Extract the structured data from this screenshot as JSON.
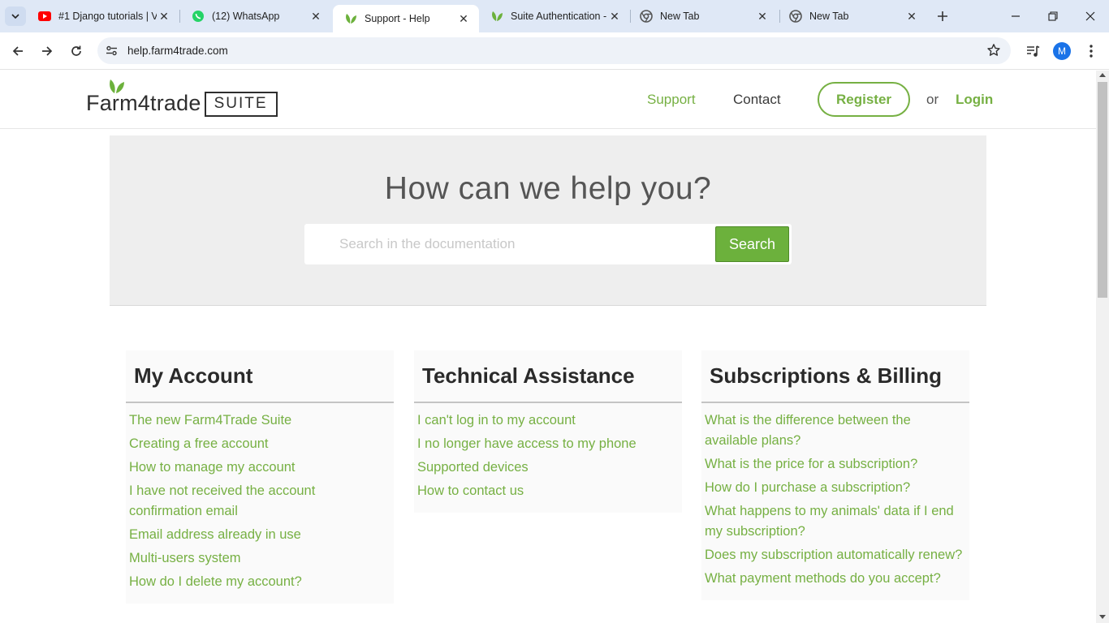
{
  "browser": {
    "tabs": [
      {
        "title": "#1 Django tutorials | V",
        "icon": "youtube-icon",
        "active": false
      },
      {
        "title": "(12) WhatsApp",
        "icon": "whatsapp-icon",
        "active": false
      },
      {
        "title": "Support - Help",
        "icon": "leaf-icon",
        "active": true
      },
      {
        "title": "Suite Authentication -",
        "icon": "leaf-icon",
        "active": false
      },
      {
        "title": "New Tab",
        "icon": "chrome-icon",
        "active": false
      },
      {
        "title": "New Tab",
        "icon": "chrome-icon",
        "active": false
      }
    ],
    "url": "help.farm4trade.com",
    "profile_initial": "M"
  },
  "header": {
    "logo_text": "Farm4trade",
    "logo_suite": "SUITE",
    "nav_support": "Support",
    "nav_contact": "Contact",
    "register": "Register",
    "or": "or",
    "login": "Login"
  },
  "hero": {
    "title": "How can we help you?",
    "search_placeholder": "Search in the documentation",
    "search_button": "Search"
  },
  "categories": [
    {
      "title": "My Account",
      "links": [
        "The new Farm4Trade Suite",
        "Creating a free account",
        "How to manage my account",
        "I have not received the account confirmation email",
        "Email address already in use",
        "Multi-users system",
        "How do I delete my account?"
      ]
    },
    {
      "title": "Technical Assistance",
      "links": [
        "I can't log in to my account",
        "I no longer have access to my phone",
        "Supported devices",
        "How to contact us"
      ]
    },
    {
      "title": "Subscriptions & Billing",
      "links": [
        "What is the difference between the available plans?",
        "What is the price for a subscription?",
        "How do I purchase a subscription?",
        "What happens to my animals' data if I end my subscription?",
        "Does my subscription automatically renew?",
        "What payment methods do you accept?"
      ]
    }
  ],
  "colors": {
    "brand_green": "#76b043",
    "search_button": "#6cb13c",
    "hero_bg": "#eeeeee"
  }
}
